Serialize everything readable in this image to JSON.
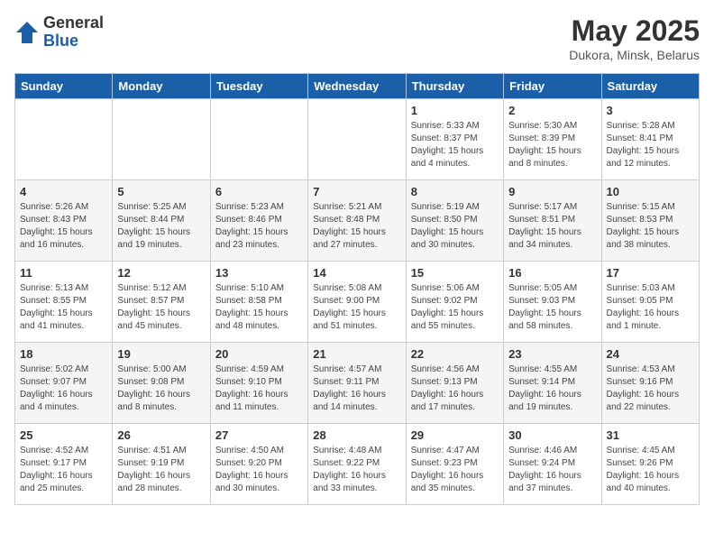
{
  "header": {
    "logo_general": "General",
    "logo_blue": "Blue",
    "month_title": "May 2025",
    "location": "Dukora, Minsk, Belarus"
  },
  "days_of_week": [
    "Sunday",
    "Monday",
    "Tuesday",
    "Wednesday",
    "Thursday",
    "Friday",
    "Saturday"
  ],
  "weeks": [
    [
      {
        "day": "",
        "info": ""
      },
      {
        "day": "",
        "info": ""
      },
      {
        "day": "",
        "info": ""
      },
      {
        "day": "",
        "info": ""
      },
      {
        "day": "1",
        "info": "Sunrise: 5:33 AM\nSunset: 8:37 PM\nDaylight: 15 hours\nand 4 minutes."
      },
      {
        "day": "2",
        "info": "Sunrise: 5:30 AM\nSunset: 8:39 PM\nDaylight: 15 hours\nand 8 minutes."
      },
      {
        "day": "3",
        "info": "Sunrise: 5:28 AM\nSunset: 8:41 PM\nDaylight: 15 hours\nand 12 minutes."
      }
    ],
    [
      {
        "day": "4",
        "info": "Sunrise: 5:26 AM\nSunset: 8:43 PM\nDaylight: 15 hours\nand 16 minutes."
      },
      {
        "day": "5",
        "info": "Sunrise: 5:25 AM\nSunset: 8:44 PM\nDaylight: 15 hours\nand 19 minutes."
      },
      {
        "day": "6",
        "info": "Sunrise: 5:23 AM\nSunset: 8:46 PM\nDaylight: 15 hours\nand 23 minutes."
      },
      {
        "day": "7",
        "info": "Sunrise: 5:21 AM\nSunset: 8:48 PM\nDaylight: 15 hours\nand 27 minutes."
      },
      {
        "day": "8",
        "info": "Sunrise: 5:19 AM\nSunset: 8:50 PM\nDaylight: 15 hours\nand 30 minutes."
      },
      {
        "day": "9",
        "info": "Sunrise: 5:17 AM\nSunset: 8:51 PM\nDaylight: 15 hours\nand 34 minutes."
      },
      {
        "day": "10",
        "info": "Sunrise: 5:15 AM\nSunset: 8:53 PM\nDaylight: 15 hours\nand 38 minutes."
      }
    ],
    [
      {
        "day": "11",
        "info": "Sunrise: 5:13 AM\nSunset: 8:55 PM\nDaylight: 15 hours\nand 41 minutes."
      },
      {
        "day": "12",
        "info": "Sunrise: 5:12 AM\nSunset: 8:57 PM\nDaylight: 15 hours\nand 45 minutes."
      },
      {
        "day": "13",
        "info": "Sunrise: 5:10 AM\nSunset: 8:58 PM\nDaylight: 15 hours\nand 48 minutes."
      },
      {
        "day": "14",
        "info": "Sunrise: 5:08 AM\nSunset: 9:00 PM\nDaylight: 15 hours\nand 51 minutes."
      },
      {
        "day": "15",
        "info": "Sunrise: 5:06 AM\nSunset: 9:02 PM\nDaylight: 15 hours\nand 55 minutes."
      },
      {
        "day": "16",
        "info": "Sunrise: 5:05 AM\nSunset: 9:03 PM\nDaylight: 15 hours\nand 58 minutes."
      },
      {
        "day": "17",
        "info": "Sunrise: 5:03 AM\nSunset: 9:05 PM\nDaylight: 16 hours\nand 1 minute."
      }
    ],
    [
      {
        "day": "18",
        "info": "Sunrise: 5:02 AM\nSunset: 9:07 PM\nDaylight: 16 hours\nand 4 minutes."
      },
      {
        "day": "19",
        "info": "Sunrise: 5:00 AM\nSunset: 9:08 PM\nDaylight: 16 hours\nand 8 minutes."
      },
      {
        "day": "20",
        "info": "Sunrise: 4:59 AM\nSunset: 9:10 PM\nDaylight: 16 hours\nand 11 minutes."
      },
      {
        "day": "21",
        "info": "Sunrise: 4:57 AM\nSunset: 9:11 PM\nDaylight: 16 hours\nand 14 minutes."
      },
      {
        "day": "22",
        "info": "Sunrise: 4:56 AM\nSunset: 9:13 PM\nDaylight: 16 hours\nand 17 minutes."
      },
      {
        "day": "23",
        "info": "Sunrise: 4:55 AM\nSunset: 9:14 PM\nDaylight: 16 hours\nand 19 minutes."
      },
      {
        "day": "24",
        "info": "Sunrise: 4:53 AM\nSunset: 9:16 PM\nDaylight: 16 hours\nand 22 minutes."
      }
    ],
    [
      {
        "day": "25",
        "info": "Sunrise: 4:52 AM\nSunset: 9:17 PM\nDaylight: 16 hours\nand 25 minutes."
      },
      {
        "day": "26",
        "info": "Sunrise: 4:51 AM\nSunset: 9:19 PM\nDaylight: 16 hours\nand 28 minutes."
      },
      {
        "day": "27",
        "info": "Sunrise: 4:50 AM\nSunset: 9:20 PM\nDaylight: 16 hours\nand 30 minutes."
      },
      {
        "day": "28",
        "info": "Sunrise: 4:48 AM\nSunset: 9:22 PM\nDaylight: 16 hours\nand 33 minutes."
      },
      {
        "day": "29",
        "info": "Sunrise: 4:47 AM\nSunset: 9:23 PM\nDaylight: 16 hours\nand 35 minutes."
      },
      {
        "day": "30",
        "info": "Sunrise: 4:46 AM\nSunset: 9:24 PM\nDaylight: 16 hours\nand 37 minutes."
      },
      {
        "day": "31",
        "info": "Sunrise: 4:45 AM\nSunset: 9:26 PM\nDaylight: 16 hours\nand 40 minutes."
      }
    ]
  ]
}
